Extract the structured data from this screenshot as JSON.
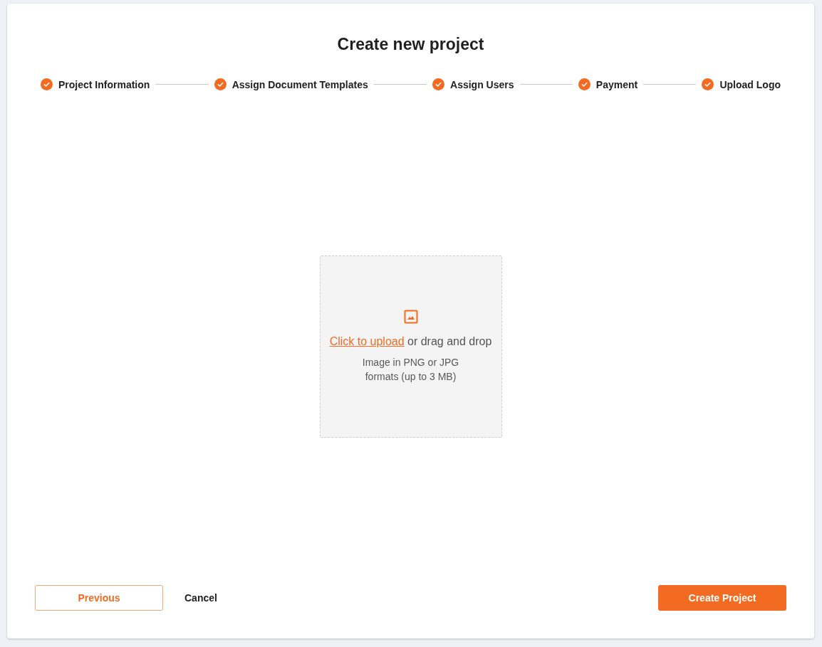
{
  "title": "Create new project",
  "steps": [
    {
      "label": "Project Information",
      "completed": true
    },
    {
      "label": "Assign Document Templates",
      "completed": true
    },
    {
      "label": "Assign Users",
      "completed": true
    },
    {
      "label": "Payment",
      "completed": true
    },
    {
      "label": "Upload Logo",
      "completed": true
    }
  ],
  "upload": {
    "link": "Click to upload",
    "text": " or drag and drop",
    "hint": "Image in PNG or JPG formats (up to 3 MB)"
  },
  "footer": {
    "previous": "Previous",
    "cancel": "Cancel",
    "submit": "Create Project"
  }
}
